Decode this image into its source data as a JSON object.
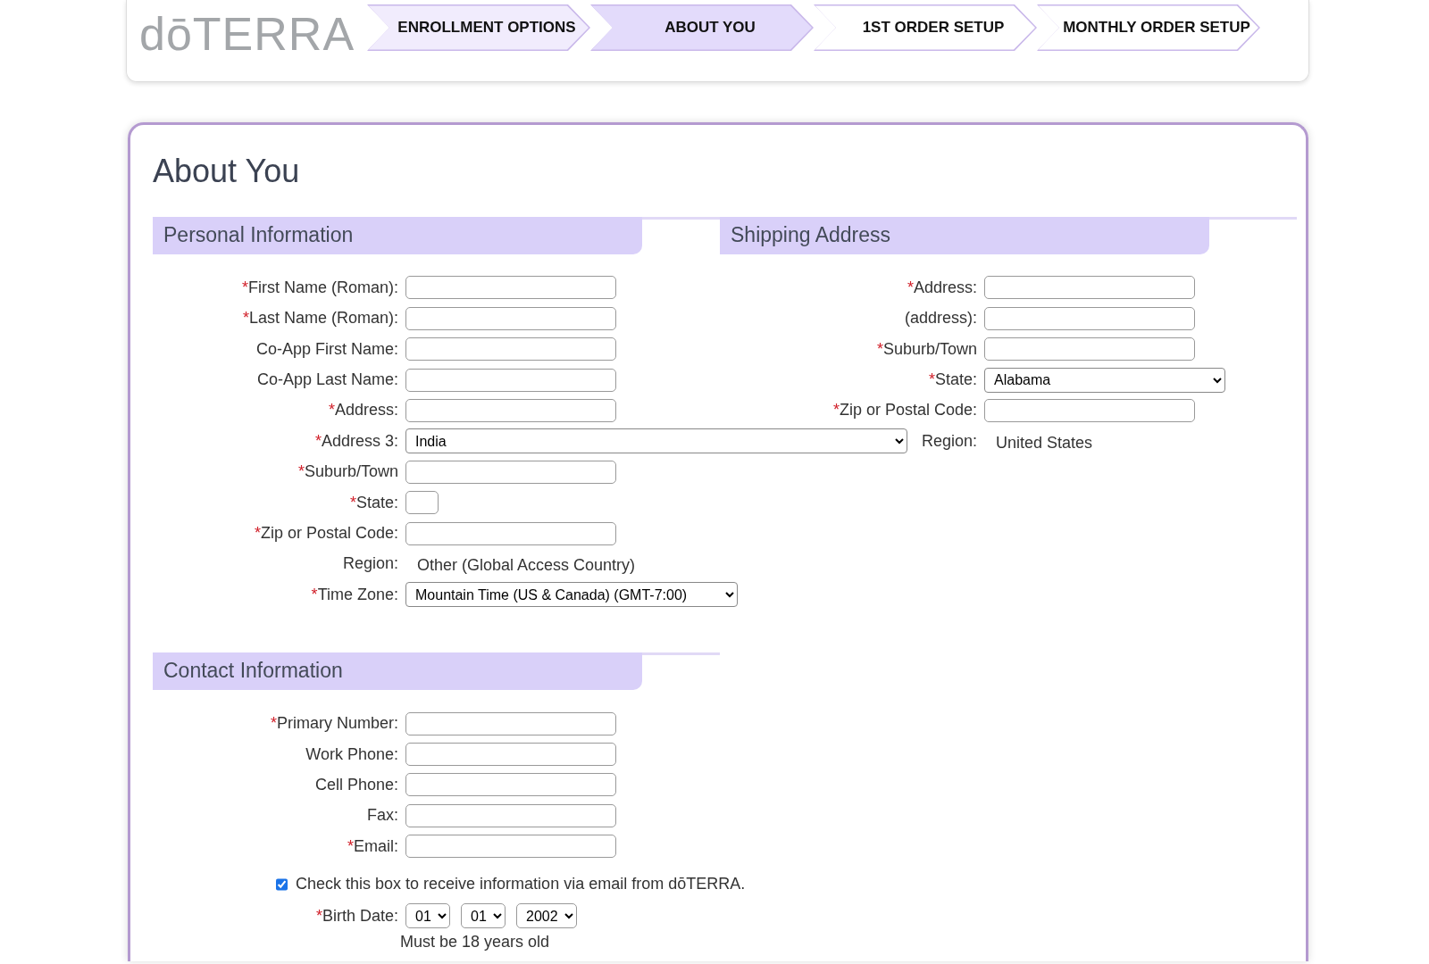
{
  "logo": {
    "text": "dōTERRA"
  },
  "steps": [
    {
      "label": "ENROLLMENT OPTIONS",
      "selected": false,
      "completed": true
    },
    {
      "label": "ABOUT YOU",
      "selected": true,
      "completed": false
    },
    {
      "label": "1ST ORDER SETUP",
      "selected": false,
      "completed": false
    },
    {
      "label": "MONTHLY ORDER SETUP",
      "selected": false,
      "completed": false
    }
  ],
  "page_title": "About You",
  "personal_information": {
    "title": "Personal Information",
    "fields": [
      {
        "kind": "text",
        "required_mark": "*",
        "label": "First Name (Roman):"
      },
      {
        "kind": "text",
        "required_mark": "*",
        "label": "Last Name (Roman):"
      },
      {
        "kind": "text",
        "label": "Co-App First Name:"
      },
      {
        "kind": "text",
        "label": "Co-App Last Name:"
      },
      {
        "kind": "text",
        "required_mark": "*",
        "label": "Address:"
      },
      {
        "kind": "wide-select",
        "required_mark": "*",
        "label": "Address 3:",
        "value": "India"
      },
      {
        "kind": "text",
        "required_mark": "*",
        "label": "Suburb/Town"
      },
      {
        "kind": "short",
        "required_mark": "*",
        "label": "State:"
      },
      {
        "kind": "text",
        "required_mark": "*",
        "label": "Zip or Postal Code:"
      },
      {
        "kind": "static",
        "label": "Region:",
        "value": "Other (Global Access Country)"
      },
      {
        "kind": "select",
        "required_mark": "*",
        "label": "Time Zone:",
        "value": "Mountain Time (US & Canada) (GMT-7:00)"
      }
    ]
  },
  "shipping_address": {
    "title": "Shipping Address",
    "fields": [
      {
        "kind": "text",
        "required_mark": "*",
        "label": "Address:"
      },
      {
        "kind": "text",
        "label": "(address):"
      },
      {
        "kind": "text",
        "required_mark": "*",
        "label": "Suburb/Town"
      },
      {
        "kind": "state-select",
        "required_mark": "*",
        "label": "State:",
        "value": "Alabama"
      },
      {
        "kind": "text",
        "required_mark": "*",
        "label": "Zip or Postal Code:"
      },
      {
        "kind": "static",
        "label": "Region:",
        "value": "United States"
      }
    ]
  },
  "contact_information": {
    "title": "Contact Information",
    "fields": [
      {
        "kind": "text",
        "required_mark": "*",
        "label": "Primary Number:"
      },
      {
        "kind": "text",
        "label": "Work Phone:"
      },
      {
        "kind": "text",
        "label": "Cell Phone:"
      },
      {
        "kind": "text",
        "label": "Fax:"
      },
      {
        "kind": "text",
        "required_mark": "*",
        "label": "Email:"
      }
    ],
    "email_opt_in": {
      "label": "Check this box to receive information via email from dōTERRA.",
      "checked": true
    },
    "birth_date": {
      "required_mark": "*",
      "label": "Birth Date:",
      "month": "01",
      "day": "01",
      "year": "2002",
      "note": "Must be 18 years old"
    }
  }
}
